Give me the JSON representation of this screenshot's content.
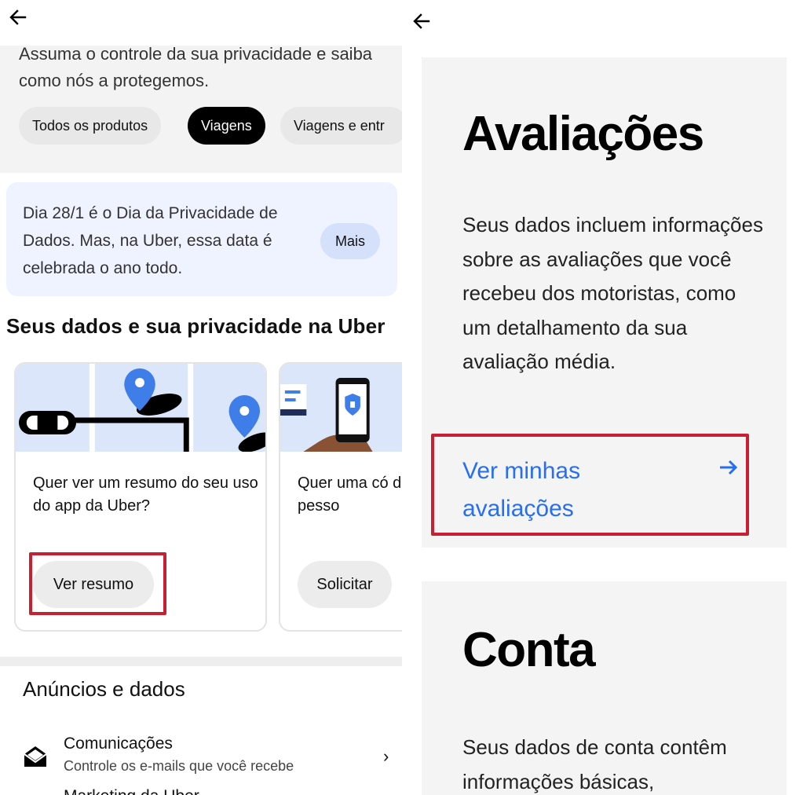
{
  "left": {
    "intro_text": "Assuma o controle da sua privacidade e saiba como nós a protegemos.",
    "chips": [
      "Todos os produtos",
      "Viagens",
      "Viagens e entr"
    ],
    "active_chip": "Viagens",
    "banner": {
      "text": "Dia 28/1 é o Dia da Privacidade de Dados. Mas, na Uber, essa data é celebrada o ano todo.",
      "button": "Mais"
    },
    "section_title": "Seus dados e sua privacidade na Uber",
    "cards": [
      {
        "text": "Quer ver um resumo do seu uso do app da Uber?",
        "button": "Ver resumo"
      },
      {
        "text": "Quer uma có dados pesso",
        "button": "Solicitar"
      }
    ],
    "ads_title": "Anúncios e dados",
    "list": [
      {
        "title": "Comunicações",
        "subtitle": "Controle os e-mails que você recebe",
        "icon": "envelope-icon"
      }
    ],
    "next_item_title": "Marketing da Uber"
  },
  "right": {
    "ratings": {
      "heading": "Avaliações",
      "body": "Seus dados incluem informações sobre as avaliações que você recebeu dos motoristas, como um detalhamento da sua avaliação média.",
      "link": "Ver minhas avaliações"
    },
    "account": {
      "heading": "Conta",
      "body": "Seus dados de conta contêm informações básicas,"
    }
  },
  "colors": {
    "accent_link": "#276ef1",
    "highlight_box": "#c62032",
    "chip_active_bg": "#000000",
    "banner_bg": "#eef3ff",
    "map_pin": "#3f7ee8"
  }
}
